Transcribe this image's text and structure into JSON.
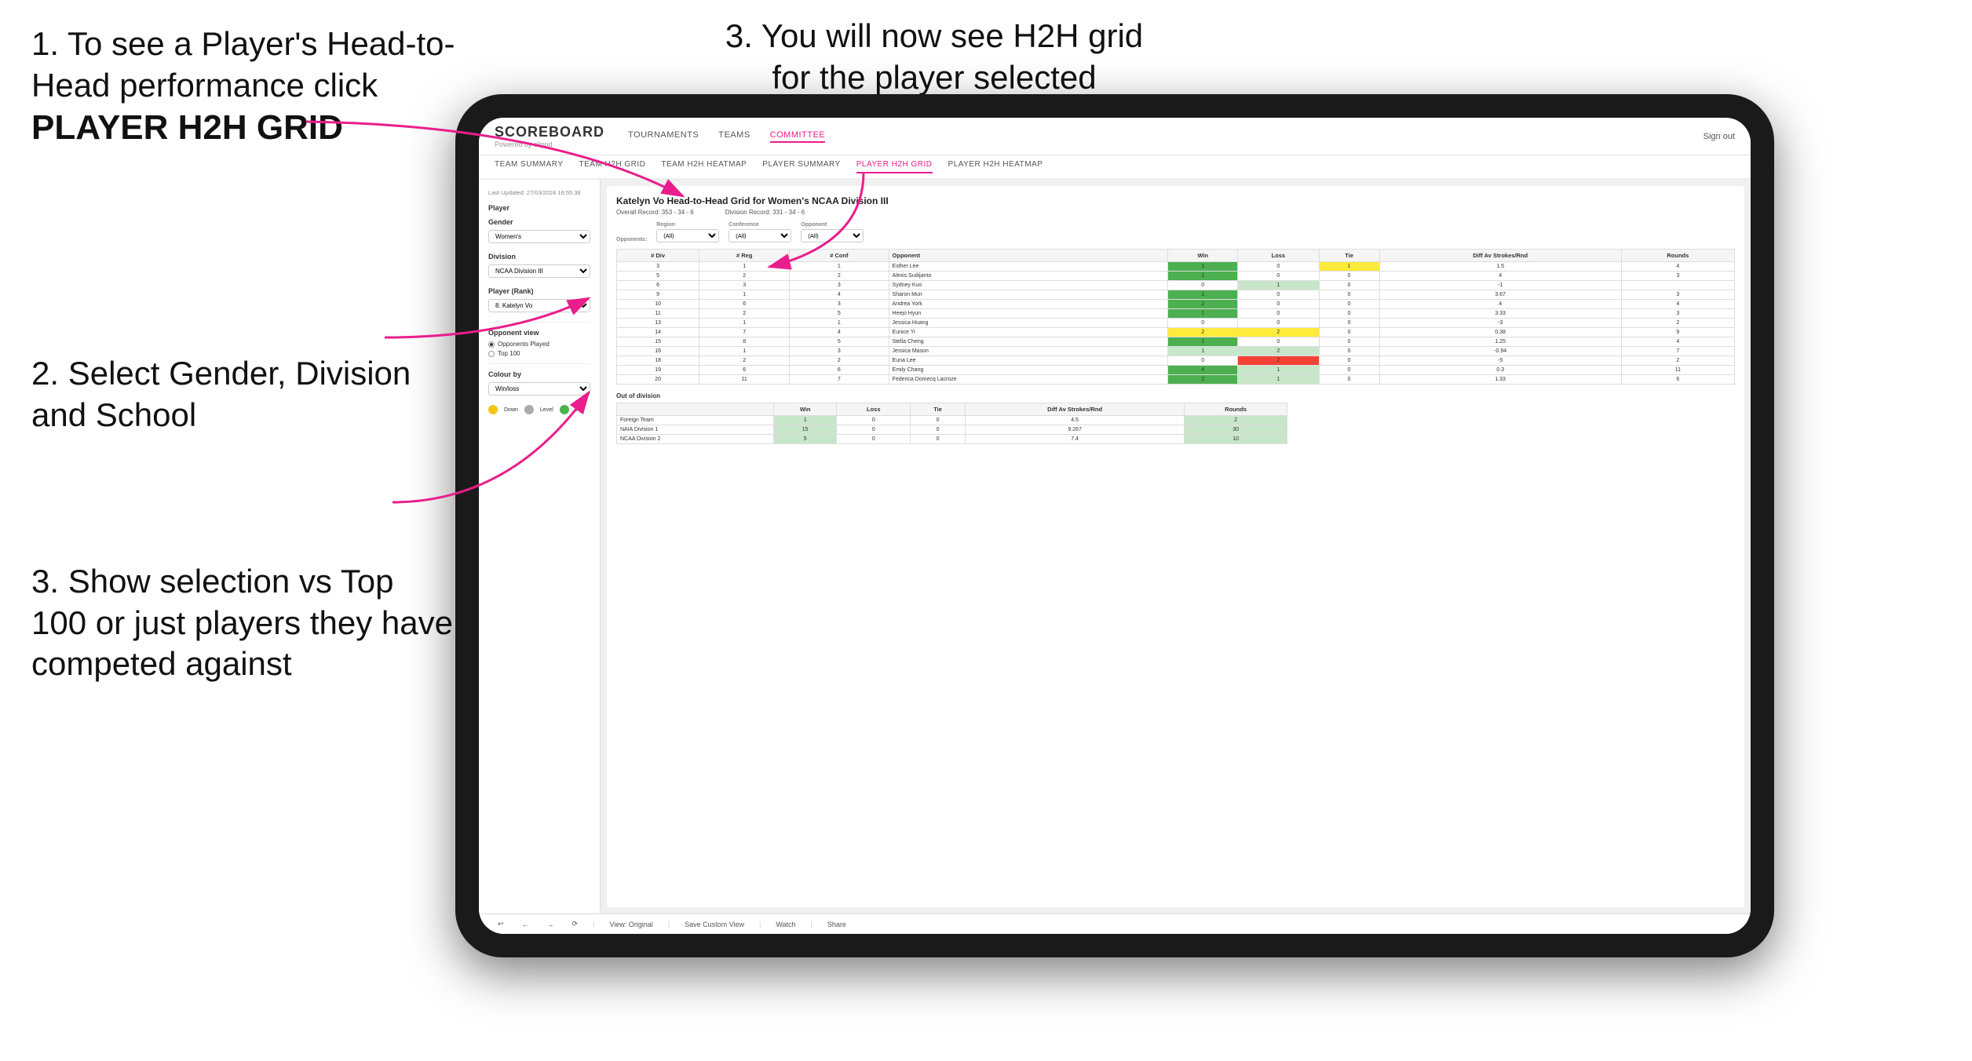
{
  "instructions": {
    "step1": {
      "text": "1. To see a Player's Head-to-Head performance click",
      "bold": "PLAYER H2H GRID"
    },
    "step2": {
      "text": "2. Select Gender, Division and School"
    },
    "step3a": {
      "text": "3. You will now see H2H grid for the player selected"
    },
    "step3b": {
      "text": "3. Show selection vs Top 100 or just players they have competed against"
    }
  },
  "nav": {
    "logo": "SCOREBOARD",
    "logo_sub": "Powered by clippd",
    "links": [
      "TOURNAMENTS",
      "TEAMS",
      "COMMITTEE"
    ],
    "active_link": "COMMITTEE",
    "sign_out": "Sign out"
  },
  "sub_nav": {
    "links": [
      "TEAM SUMMARY",
      "TEAM H2H GRID",
      "TEAM H2H HEATMAP",
      "PLAYER SUMMARY",
      "PLAYER H2H GRID",
      "PLAYER H2H HEATMAP"
    ],
    "active": "PLAYER H2H GRID"
  },
  "sidebar": {
    "timestamp": "Last Updated: 27/03/2024 16:55:38",
    "player_label": "Player",
    "gender_label": "Gender",
    "gender_value": "Women's",
    "division_label": "Division",
    "division_value": "NCAA Division III",
    "player_rank_label": "Player (Rank)",
    "player_rank_value": "8. Katelyn Vo",
    "opponent_view_label": "Opponent view",
    "radio_options": [
      "Opponents Played",
      "Top 100"
    ],
    "selected_radio": "Opponents Played",
    "colour_by_label": "Colour by",
    "colour_by_value": "Win/loss",
    "legend": [
      {
        "color": "#f5c518",
        "label": "Down"
      },
      {
        "color": "#aaa",
        "label": "Level"
      },
      {
        "color": "#4caf50",
        "label": "Up"
      }
    ]
  },
  "grid": {
    "title": "Katelyn Vo Head-to-Head Grid for Women's NCAA Division III",
    "overall_record": "Overall Record: 353 - 34 - 6",
    "division_record": "Division Record: 331 - 34 - 6",
    "opponents_label": "Opponents:",
    "region_label": "Region",
    "conference_label": "Conference",
    "opponent_label": "Opponent",
    "filter_all": "(All)",
    "col_headers": [
      "# Div",
      "# Reg",
      "# Conf",
      "Opponent",
      "Win",
      "Loss",
      "Tie",
      "Diff Av Strokes/Rnd",
      "Rounds"
    ],
    "rows": [
      {
        "div": 3,
        "reg": 1,
        "conf": 1,
        "opponent": "Esther Lee",
        "win": 1,
        "loss": 0,
        "tie": 1,
        "diff": 1.5,
        "rounds": 4,
        "win_color": "green",
        "loss_color": "",
        "tie_color": "yellow"
      },
      {
        "div": 5,
        "reg": 2,
        "conf": 2,
        "opponent": "Alexis Sudijanto",
        "win": 1,
        "loss": 0,
        "tie": 0,
        "diff": 4.0,
        "rounds": 3,
        "win_color": "green",
        "loss_color": "",
        "tie_color": ""
      },
      {
        "div": 6,
        "reg": 3,
        "conf": 3,
        "opponent": "Sydney Kuo",
        "win": 0,
        "loss": 1,
        "tie": 0,
        "diff": -1.0,
        "rounds": "",
        "win_color": "",
        "loss_color": "green-light",
        "tie_color": ""
      },
      {
        "div": 9,
        "reg": 1,
        "conf": 4,
        "opponent": "Sharon Mun",
        "win": 1,
        "loss": 0,
        "tie": 0,
        "diff": 3.67,
        "rounds": 3,
        "win_color": "green",
        "loss_color": "",
        "tie_color": ""
      },
      {
        "div": 10,
        "reg": 6,
        "conf": 3,
        "opponent": "Andrea York",
        "win": 2,
        "loss": 0,
        "tie": 0,
        "diff": 4.0,
        "rounds": 4,
        "win_color": "green",
        "loss_color": "",
        "tie_color": ""
      },
      {
        "div": 11,
        "reg": 2,
        "conf": 5,
        "opponent": "Heejo Hyun",
        "win": 1,
        "loss": 0,
        "tie": 0,
        "diff": 3.33,
        "rounds": 3,
        "win_color": "green",
        "loss_color": "",
        "tie_color": ""
      },
      {
        "div": 13,
        "reg": 1,
        "conf": 1,
        "opponent": "Jessica Huang",
        "win": 0,
        "loss": 0,
        "tie": 0,
        "diff": -3.0,
        "rounds": 2,
        "win_color": "",
        "loss_color": "",
        "tie_color": ""
      },
      {
        "div": 14,
        "reg": 7,
        "conf": 4,
        "opponent": "Eunice Yi",
        "win": 2,
        "loss": 2,
        "tie": 0,
        "diff": 0.38,
        "rounds": 9,
        "win_color": "yellow",
        "loss_color": "yellow",
        "tie_color": ""
      },
      {
        "div": 15,
        "reg": 8,
        "conf": 5,
        "opponent": "Stella Cheng",
        "win": 1,
        "loss": 0,
        "tie": 0,
        "diff": 1.25,
        "rounds": 4,
        "win_color": "green",
        "loss_color": "",
        "tie_color": ""
      },
      {
        "div": 16,
        "reg": 1,
        "conf": 3,
        "opponent": "Jessica Mason",
        "win": 1,
        "loss": 2,
        "tie": 0,
        "diff": -0.94,
        "rounds": 7,
        "win_color": "green-light",
        "loss_color": "green-light",
        "tie_color": ""
      },
      {
        "div": 18,
        "reg": 2,
        "conf": 2,
        "opponent": "Euna Lee",
        "win": 0,
        "loss": 2,
        "tie": 0,
        "diff": -5.0,
        "rounds": 2,
        "win_color": "",
        "loss_color": "red",
        "tie_color": ""
      },
      {
        "div": 19,
        "reg": 6,
        "conf": 6,
        "opponent": "Emily Chang",
        "win": 4,
        "loss": 1,
        "tie": 0,
        "diff": 0.3,
        "rounds": 11,
        "win_color": "green",
        "loss_color": "green-light",
        "tie_color": ""
      },
      {
        "div": 20,
        "reg": 11,
        "conf": 7,
        "opponent": "Federica Domecq Lacroze",
        "win": 2,
        "loss": 1,
        "tie": 0,
        "diff": 1.33,
        "rounds": 6,
        "win_color": "green",
        "loss_color": "green-light",
        "tie_color": ""
      }
    ],
    "out_of_division_label": "Out of division",
    "out_of_division_rows": [
      {
        "name": "Foreign Team",
        "win": 1,
        "loss": 0,
        "tie": 0,
        "diff": 4.5,
        "rounds": 2
      },
      {
        "name": "NAIA Division 1",
        "win": 15,
        "loss": 0,
        "tie": 0,
        "diff": 9.267,
        "rounds": 30
      },
      {
        "name": "NCAA Division 2",
        "win": 5,
        "loss": 0,
        "tie": 0,
        "diff": 7.4,
        "rounds": 10
      }
    ]
  },
  "toolbar": {
    "view_original": "View: Original",
    "save_custom": "Save Custom View",
    "watch": "Watch",
    "share": "Share"
  }
}
